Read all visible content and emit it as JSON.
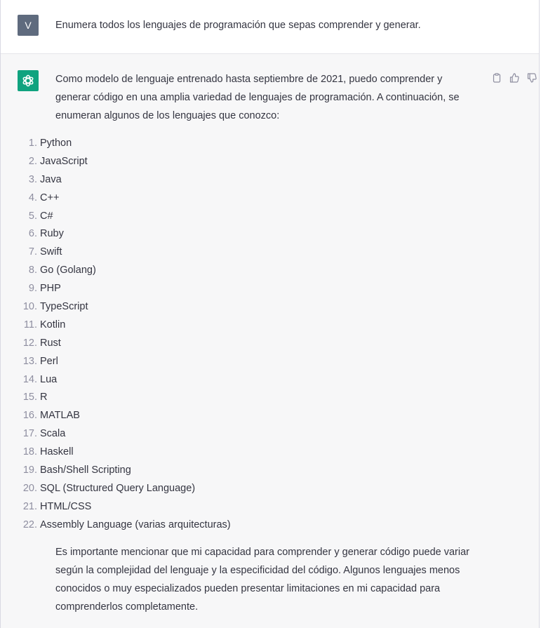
{
  "user_message": {
    "avatar_initial": "V",
    "text": "Enumera todos los lenguajes de programación que sepas comprender y generar."
  },
  "assistant_message": {
    "intro": "Como modelo de lenguaje entrenado hasta septiembre de 2021, puedo comprender y generar código en una amplia variedad de lenguajes de programación. A continuación, se enumeran algunos de los lenguajes que conozco:",
    "languages": [
      {
        "num": "1.",
        "name": "Python"
      },
      {
        "num": "2.",
        "name": "JavaScript"
      },
      {
        "num": "3.",
        "name": "Java"
      },
      {
        "num": "4.",
        "name": "C++"
      },
      {
        "num": "5.",
        "name": "C#"
      },
      {
        "num": "6.",
        "name": "Ruby"
      },
      {
        "num": "7.",
        "name": "Swift"
      },
      {
        "num": "8.",
        "name": "Go (Golang)"
      },
      {
        "num": "9.",
        "name": "PHP"
      },
      {
        "num": "10.",
        "name": "TypeScript"
      },
      {
        "num": "11.",
        "name": "Kotlin"
      },
      {
        "num": "12.",
        "name": "Rust"
      },
      {
        "num": "13.",
        "name": "Perl"
      },
      {
        "num": "14.",
        "name": "Lua"
      },
      {
        "num": "15.",
        "name": "R"
      },
      {
        "num": "16.",
        "name": "MATLAB"
      },
      {
        "num": "17.",
        "name": "Scala"
      },
      {
        "num": "18.",
        "name": "Haskell"
      },
      {
        "num": "19.",
        "name": "Bash/Shell Scripting"
      },
      {
        "num": "20.",
        "name": "SQL (Structured Query Language)"
      },
      {
        "num": "21.",
        "name": "HTML/CSS"
      },
      {
        "num": "22.",
        "name": "Assembly Language (varias arquitecturas)"
      }
    ],
    "closing": "Es importante mencionar que mi capacidad para comprender y generar código puede variar según la complejidad del lenguaje y la especificidad del código. Algunos lenguajes menos conocidos o muy especializados pueden presentar limitaciones en mi capacidad para comprenderlos completamente.",
    "actions": [
      "clipboard-icon",
      "thumbs-up-icon",
      "thumbs-down-icon"
    ]
  },
  "colors": {
    "user_avatar": "#5f6b7e",
    "bot_avatar": "#10a37f",
    "assistant_bg": "#f7f7f8",
    "text": "#343541"
  }
}
